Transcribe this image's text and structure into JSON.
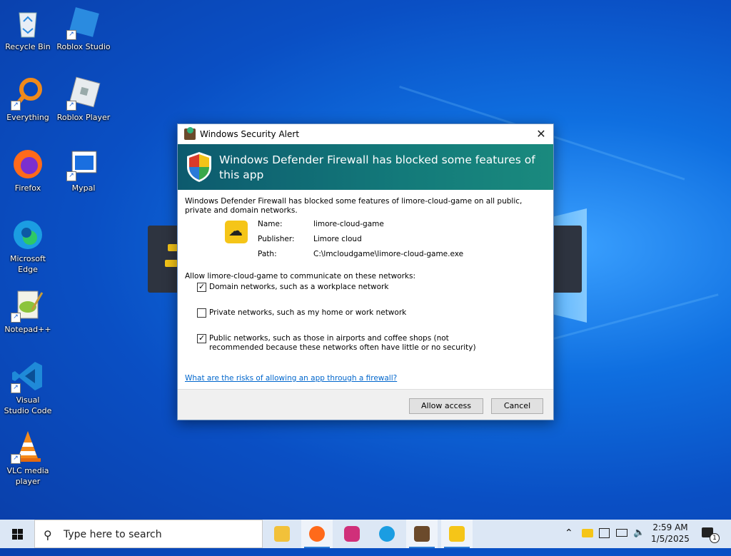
{
  "desktop_icons": [
    {
      "label": "Recycle Bin",
      "icon": "recycle-bin-icon"
    },
    {
      "label": "Roblox Studio",
      "icon": "roblox-studio-icon"
    },
    {
      "label": "Everything",
      "icon": "everything-search-icon"
    },
    {
      "label": "Roblox Player",
      "icon": "roblox-player-icon"
    },
    {
      "label": "Firefox",
      "icon": "firefox-icon"
    },
    {
      "label": "Mypal",
      "icon": "mypal-icon"
    },
    {
      "label": "Microsoft Edge",
      "icon": "edge-icon"
    },
    {
      "label": "Notepad++",
      "icon": "notepad-plus-plus-icon"
    },
    {
      "label": "Visual Studio Code",
      "icon": "vscode-icon"
    },
    {
      "label": "VLC media player",
      "icon": "vlc-icon"
    }
  ],
  "dialog": {
    "title": "Windows Security Alert",
    "close_glyph": "✕",
    "banner_text": "Windows Defender Firewall has blocked some features of this app",
    "intro": "Windows Defender Firewall has blocked some features of limore-cloud-game on all public, private and domain networks.",
    "name_label": "Name:",
    "name_value": "limore-cloud-game",
    "publisher_label": "Publisher:",
    "publisher_value": "Limore cloud",
    "path_label": "Path:",
    "path_value": "C:\\lmcloudgame\\limore-cloud-game.exe",
    "allow_text": "Allow limore-cloud-game to communicate on these networks:",
    "options": [
      {
        "label": "Domain networks, such as a workplace network",
        "checked": true
      },
      {
        "label": "Private networks, such as my home or work network",
        "checked": false
      },
      {
        "label": "Public networks, such as those in airports and coffee shops (not recommended because these networks often have little or no security)",
        "checked": true
      }
    ],
    "risk_link": "What are the risks of allowing an app through a firewall?",
    "allow_button": "Allow access",
    "cancel_button": "Cancel"
  },
  "taskbar": {
    "search_placeholder": "Type here to search",
    "apps": [
      "file-explorer-icon",
      "firefox-icon",
      "app-icon",
      "edge-icon",
      "security-app-icon",
      "limore-cloud-icon"
    ],
    "clock_time": "2:59 AM",
    "clock_date": "1/5/2025",
    "notification_count": "1"
  }
}
